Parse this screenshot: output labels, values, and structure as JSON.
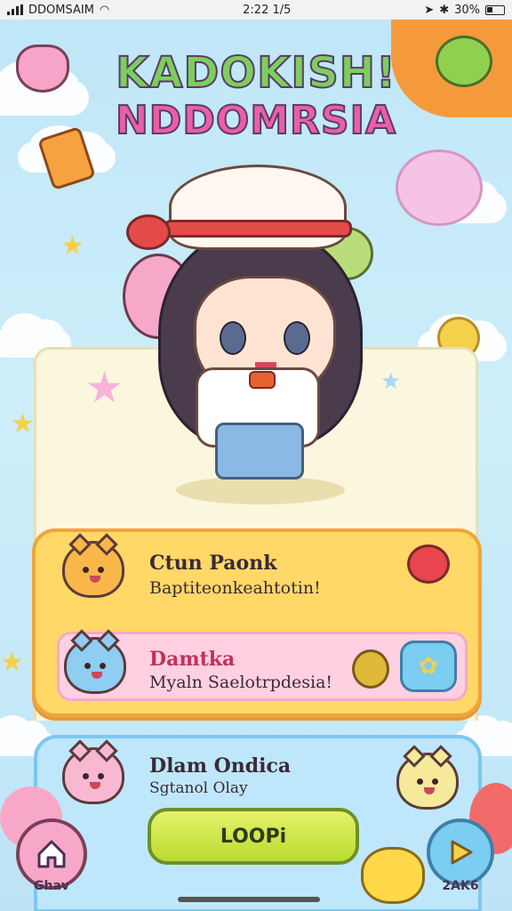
{
  "status": {
    "carrier": "DDOMSAIM",
    "time": "2:22 1/5",
    "battery": "30%"
  },
  "title": {
    "line1": "KADOKISH!",
    "line2": "NDDOMRSIA"
  },
  "rows": [
    {
      "name": "Ctun Paonk",
      "subtitle": "Baptiteonkeahtotin!"
    },
    {
      "name": "Damtka",
      "subtitle": "Myaln Saelotrpdesia!"
    },
    {
      "name": "Dlam Ondica",
      "subtitle": "Sgtanol Olay"
    }
  ],
  "buttons": {
    "load": "LOOPi",
    "left_label": "Ghav",
    "right_label": "2AK6"
  },
  "colors": {
    "panel_yellow": "#ffd867",
    "panel_pink": "#ffd0e2",
    "panel_blue": "#bfe7fb",
    "load_green": "#c6e23e"
  },
  "icons": [
    "signal-icon",
    "wifi-icon",
    "location-icon",
    "bluetooth-icon",
    "battery-icon",
    "heart-balloon-icon",
    "coin-icon",
    "star-badge-icon",
    "home-icon",
    "play-icon"
  ]
}
